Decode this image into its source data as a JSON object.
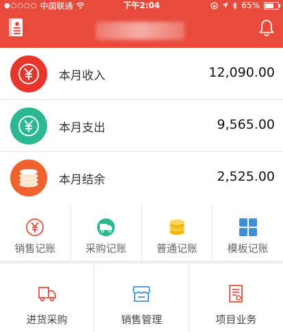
{
  "status_bar": {
    "signal_dots": "●○○○○",
    "carrier": "中国联通",
    "time": "下午2:04",
    "battery": "65%",
    "battery_level": 0.65
  },
  "nav": {
    "left_icon": "account-book-icon",
    "right_icon": "bell-icon"
  },
  "summary": [
    {
      "label": "本月收入",
      "amount": "12,090.00",
      "icon": "yuan-icon",
      "color": "#e8362b"
    },
    {
      "label": "本月支出",
      "amount": "9,565.00",
      "icon": "yuan-icon",
      "color": "#2bb893"
    },
    {
      "label": "本月结余",
      "amount": "2,525.00",
      "icon": "coins-icon",
      "color": "#f0622d"
    }
  ],
  "quick_actions": [
    {
      "label": "销售记账",
      "icon": "yuan-outline-icon",
      "color": "#e84b3c"
    },
    {
      "label": "采购记账",
      "icon": "truck-icon",
      "color": "#2bb893"
    },
    {
      "label": "普通记账",
      "icon": "coins-icon",
      "color": "#f2b70a"
    },
    {
      "label": "模板记账",
      "icon": "grid-icon",
      "color": "#3d8fd8"
    }
  ],
  "modules": [
    {
      "label": "进货采购",
      "icon": "truck-outline-icon",
      "color": "#e84b3c"
    },
    {
      "label": "销售管理",
      "icon": "store-icon",
      "color": "#3d8fd8"
    },
    {
      "label": "项目业务",
      "icon": "document-icon",
      "color": "#e84b3c"
    }
  ]
}
